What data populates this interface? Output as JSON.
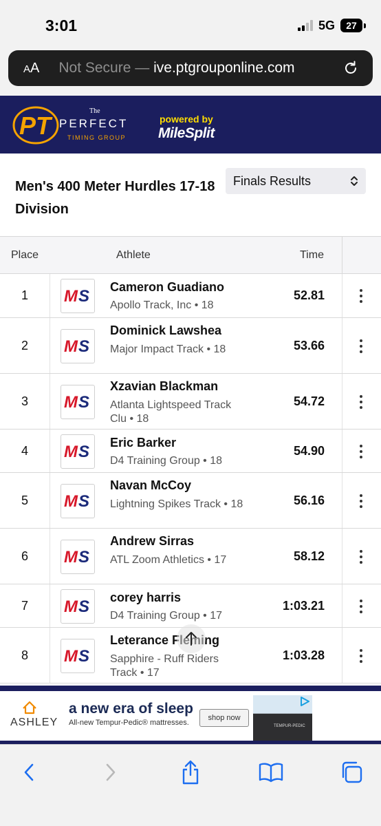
{
  "status_bar": {
    "time": "3:01",
    "network": "5G",
    "battery": "27"
  },
  "browser": {
    "aa_label": "AA",
    "security": "Not Secure —",
    "domain": "ive.ptgrouponline.com"
  },
  "site_header": {
    "brand_prefix": "The",
    "brand_name": "PERFECT",
    "brand_sub": "TIMING GROUP",
    "logo_letters": "PT",
    "powered_by": "powered by",
    "partner": "MileSplit"
  },
  "event": {
    "title": "Men's 400 Meter Hurdles 17-18 Division",
    "select_value": "Finals Results"
  },
  "table": {
    "headers": {
      "place": "Place",
      "athlete": "Athlete",
      "time": "Time"
    },
    "rows": [
      {
        "place": "1",
        "name": "Cameron Guadiano",
        "team": "Apollo Track, Inc • 18",
        "time": "52.81"
      },
      {
        "place": "2",
        "name": "Dominick Lawshea",
        "team": "Major Impact Track • 18",
        "time": "53.66"
      },
      {
        "place": "3",
        "name": "Xzavian Blackman",
        "team": "Atlanta Lightspeed Track Clu • 18",
        "time": "54.72"
      },
      {
        "place": "4",
        "name": "Eric Barker",
        "team": "D4 Training Group • 18",
        "time": "54.90"
      },
      {
        "place": "5",
        "name": "Navan McCoy",
        "team": "Lightning Spikes Track • 18",
        "time": "56.16"
      },
      {
        "place": "6",
        "name": "Andrew Sirras",
        "team": "ATL Zoom Athletics • 17",
        "time": "58.12"
      },
      {
        "place": "7",
        "name": "corey harris",
        "team": "D4 Training Group • 17",
        "time": "1:03.21"
      },
      {
        "place": "8",
        "name": "Leterance Fleming",
        "team": "Sapphire - Ruff Riders Track • 17",
        "time": "1:03.28"
      }
    ]
  },
  "ad": {
    "brand": "ASHLEY",
    "headline": "a new era of sleep",
    "subline": "All-new Tempur-Pedic® mattresses.",
    "cta": "shop now",
    "product_label": "TEMPUR-PEDIC"
  },
  "colors": {
    "header_bg": "#1b1e5e",
    "accent_gold": "#f5a300",
    "ms_red": "#d7182a",
    "ms_blue": "#1b2a7a"
  },
  "icons": {
    "toolbar": [
      "back-chevron-icon",
      "forward-chevron-icon",
      "share-icon",
      "bookmarks-icon",
      "tabs-icon"
    ]
  }
}
